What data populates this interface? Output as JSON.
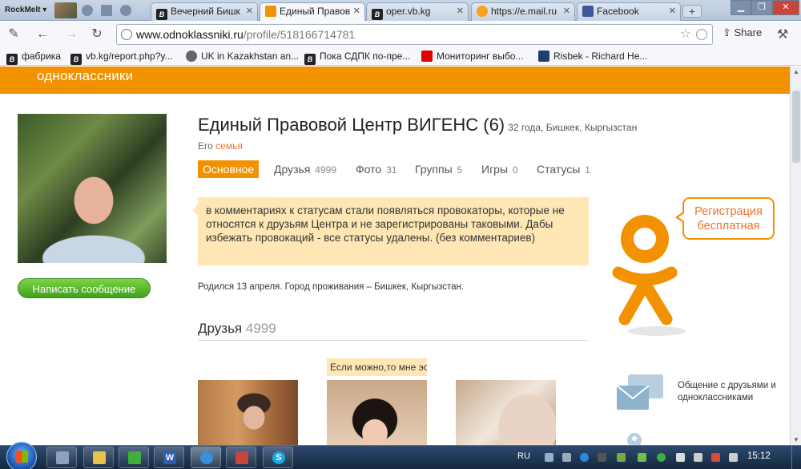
{
  "browser": {
    "rockmelt_label": "RockMelt ▾",
    "tabs": [
      {
        "label": "Вечерний Бишк",
        "fav": "vb"
      },
      {
        "label": "Единый Правов",
        "fav": "ok"
      },
      {
        "label": "oper.vb.kg",
        "fav": "vb"
      },
      {
        "label": "https://e.mail.ru",
        "fav": "mail"
      },
      {
        "label": "Facebook",
        "fav": "fb"
      }
    ],
    "new_tab": "+",
    "url_host": "www.odnoklassniki.ru",
    "url_path": "/profile/518166714781",
    "share_label": "Share",
    "bookmarks": [
      {
        "label": "фабрика"
      },
      {
        "label": "vb.kg/report.php?y..."
      },
      {
        "label": "UK in Kazakhstan an..."
      },
      {
        "label": "Пока СДПК по-пре..."
      },
      {
        "label": "Мониторинг выбо..."
      },
      {
        "label": "Risbek - Richard He..."
      }
    ]
  },
  "site": {
    "logo": "одноклассники",
    "profile": {
      "name": "Единый Правовой Центр ВИГЕНС (6)",
      "meta": "32 года, Бишкек, Кыргызстан",
      "family_prefix": "Его",
      "family_link": "семья",
      "message_button": "Написать сообщение"
    },
    "nav": [
      {
        "label": "Основное",
        "count": ""
      },
      {
        "label": "Друзья",
        "count": "4999"
      },
      {
        "label": "Фото",
        "count": "31"
      },
      {
        "label": "Группы",
        "count": "5"
      },
      {
        "label": "Игры",
        "count": "0"
      },
      {
        "label": "Статусы",
        "count": "1"
      }
    ],
    "status_text": "в комментариях к статусам стали появляться провокаторы, которые не относятся к друзьям Центра и не зарегистрированы таковыми. Дабы избежать провокаций - все статусы удалены. (без комментариев)",
    "born_text": "Родился 13 апреля. Город проживания – Бишкек, Кыргызстан.",
    "friends_title": "Друзья",
    "friends_count": "4999",
    "friend_tooltip": "Если можно,то мне эс",
    "register": "Регистрация бесплатная",
    "feature_text": "Общение с друзьями и одноклассниками"
  },
  "taskbar": {
    "lang": "RU",
    "time": "15:12"
  },
  "colors": {
    "ok_orange": "#f39200",
    "ok_link": "#eb722e",
    "status_bg": "#ffe7b5",
    "button_green": "#4caf1f"
  }
}
